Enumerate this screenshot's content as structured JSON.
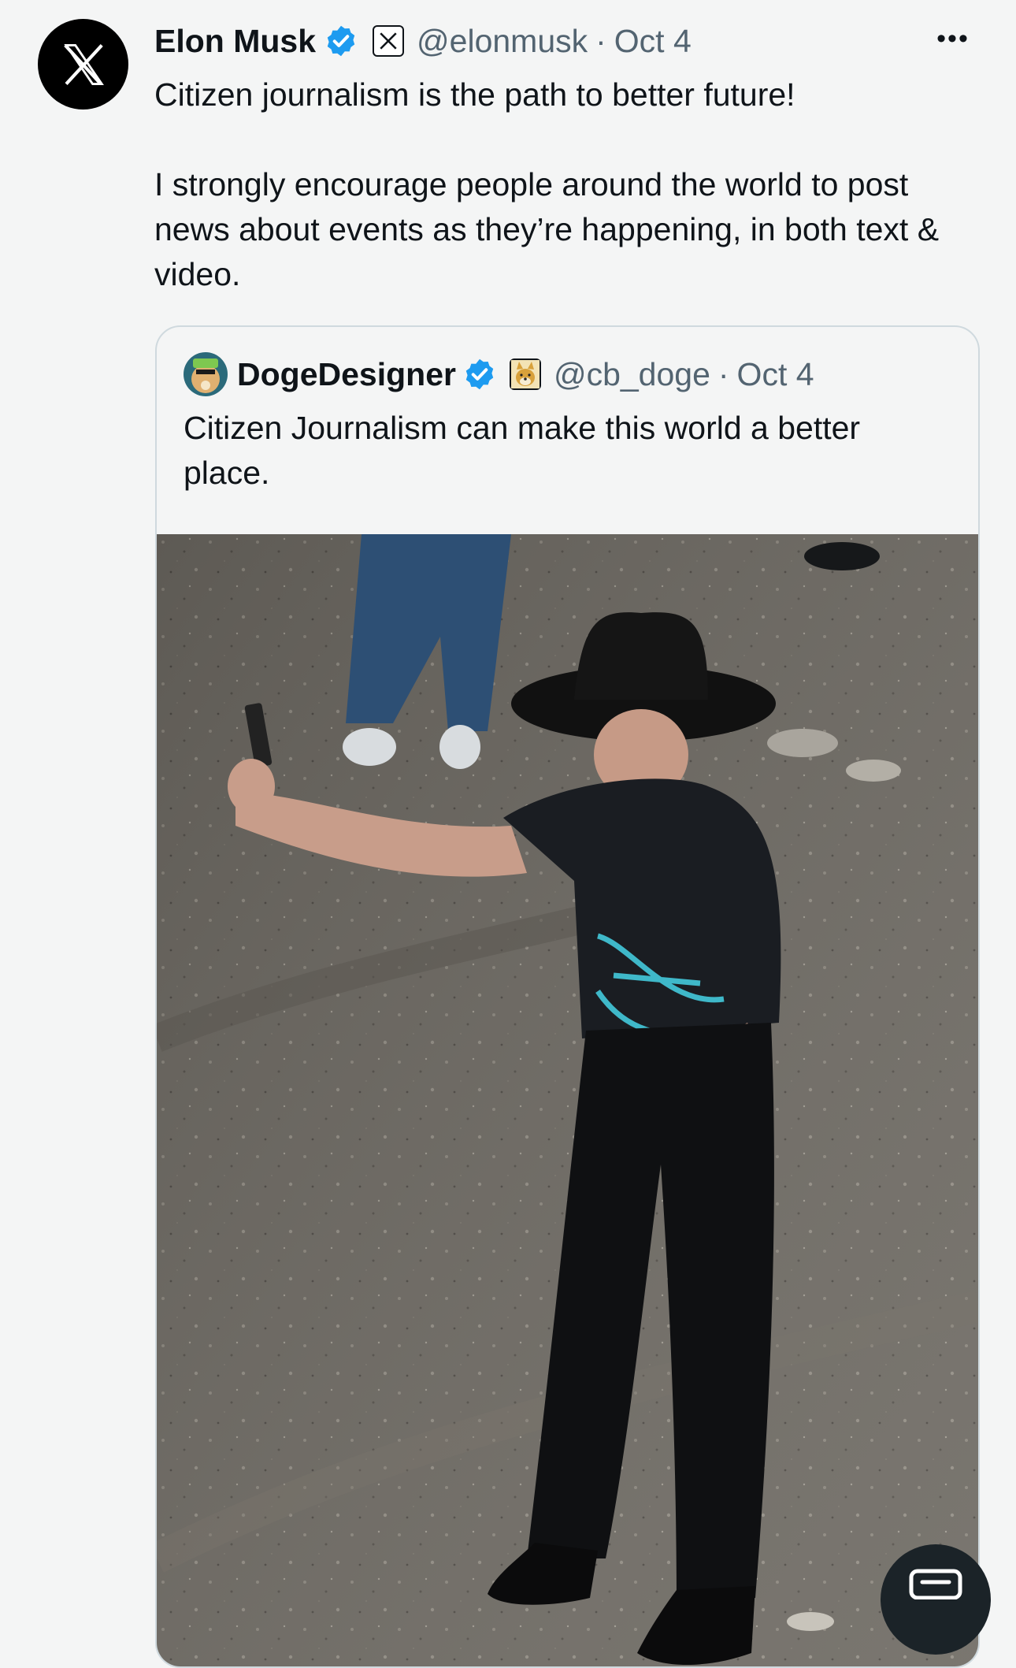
{
  "tweet": {
    "author_name": "Elon Musk",
    "author_handle": "@elonmusk",
    "separator": "·",
    "date": "Oct 4",
    "more_label": "•••",
    "paragraphs": [
      "Citizen journalism is the path to better future!",
      "I strongly encourage people around the world to post news about events as they’re happening, in both text & video."
    ],
    "icons": {
      "avatar": "x-logo-icon",
      "verified": "verified-badge-icon",
      "affiliation": "x-affiliation-icon",
      "more": "more-options-icon"
    }
  },
  "quote": {
    "author_name": "DogeDesigner",
    "author_handle": "@cb_doge",
    "separator": "·",
    "date": "Oct 4",
    "text": "Citizen Journalism can make this world a better place.",
    "media": {
      "type": "photo"
    }
  },
  "fab": {
    "icon": "compose-icon"
  },
  "colors": {
    "background": "#f4f5f5",
    "text": "#0f1419",
    "secondary_text": "#536471",
    "verified_blue": "#1d9bf0",
    "border": "#cfd9de"
  }
}
